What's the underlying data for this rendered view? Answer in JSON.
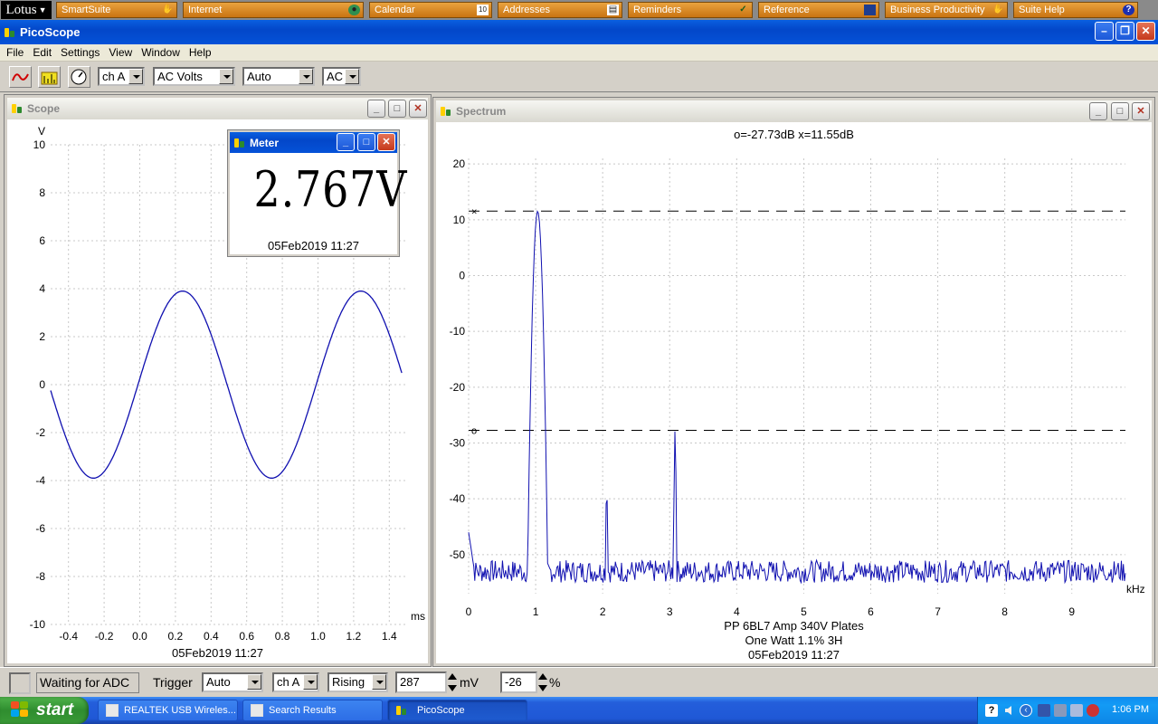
{
  "lotus_bar": {
    "logo": "Lotus",
    "items": [
      {
        "label": "SmartSuite",
        "icon": "hand-icon"
      },
      {
        "label": "Internet",
        "icon": "globe-icon"
      },
      {
        "label": "Calendar",
        "icon": "calendar-icon"
      },
      {
        "label": "Addresses",
        "icon": "address-card-icon"
      },
      {
        "label": "Reminders",
        "icon": "checkmark-icon"
      },
      {
        "label": "Reference",
        "icon": "book-icon"
      },
      {
        "label": "Business Productivity",
        "icon": "hand-icon"
      },
      {
        "label": "Suite Help",
        "icon": "help-icon"
      }
    ]
  },
  "app": {
    "title": "PicoScope"
  },
  "menu": [
    "File",
    "Edit",
    "Settings",
    "View",
    "Window",
    "Help"
  ],
  "toolbar": {
    "channel": "ch A",
    "coupling": "AC Volts",
    "range": "Auto",
    "mode": "AC"
  },
  "scope": {
    "title": "Scope",
    "y_unit": "V",
    "x_unit": "ms",
    "date": "05Feb2019  11:27"
  },
  "meter": {
    "title": "Meter",
    "value": "2.767V",
    "date": "05Feb2019  11:27"
  },
  "spectrum": {
    "title": "Spectrum",
    "cursor_readout": "o=-27.73dB  x=11.55dB",
    "x_unit": "kHz",
    "caption_lines": [
      "PP 6BL7  Amp 340V Plates",
      "One Watt 1.1% 3H",
      "05Feb2019  11:27"
    ],
    "marker_x": "×",
    "marker_o": "o"
  },
  "chart_data": [
    {
      "type": "line",
      "name_ref": "scope",
      "x_ticks": [
        -0.4,
        -0.2,
        0.0,
        0.2,
        0.4,
        0.6,
        0.8,
        1.0,
        1.2,
        1.4
      ],
      "y_ticks": [
        10,
        8,
        6,
        4,
        2,
        0,
        -2,
        -4,
        -6,
        -8,
        -10
      ],
      "xlim": [
        -0.5,
        1.5
      ],
      "ylim": [
        -10,
        10
      ],
      "waveform": {
        "amplitude": 3.9,
        "frequency_khz": 1.0,
        "peak_at_ms": 0.24,
        "x_start": -0.5,
        "x_end": 1.47
      },
      "grid": true
    },
    {
      "type": "line",
      "name_ref": "spectrum",
      "x_ticks": [
        0,
        1,
        2,
        3,
        4,
        5,
        6,
        7,
        8,
        9
      ],
      "y_ticks": [
        20,
        10,
        0,
        -10,
        -20,
        -30,
        -40,
        -50
      ],
      "xlim": [
        0,
        9.8
      ],
      "ylim": [
        -57,
        21
      ],
      "noise_floor_db": -53,
      "peaks": [
        {
          "x": 1.03,
          "y": 11.55
        },
        {
          "x": 2.06,
          "y": -38
        },
        {
          "x": 3.08,
          "y": -27.73
        }
      ],
      "cursors": [
        {
          "label": "x",
          "y": 11.55
        },
        {
          "label": "o",
          "y": -27.73
        }
      ],
      "grid": true
    }
  ],
  "statusbar": {
    "status": "Waiting for ADC",
    "trigger_label": "Trigger",
    "trigger_mode": "Auto",
    "trigger_channel": "ch A",
    "trigger_edge": "Rising",
    "trigger_level": "287",
    "level_unit": "mV",
    "pretrigger": "-26",
    "pretrigger_unit": "%"
  },
  "taskbar": {
    "start": "start",
    "tasks": [
      {
        "label": "REALTEK USB Wireles..."
      },
      {
        "label": "Search Results"
      },
      {
        "label": "PicoScope"
      }
    ],
    "clock": "1:06 PM"
  }
}
